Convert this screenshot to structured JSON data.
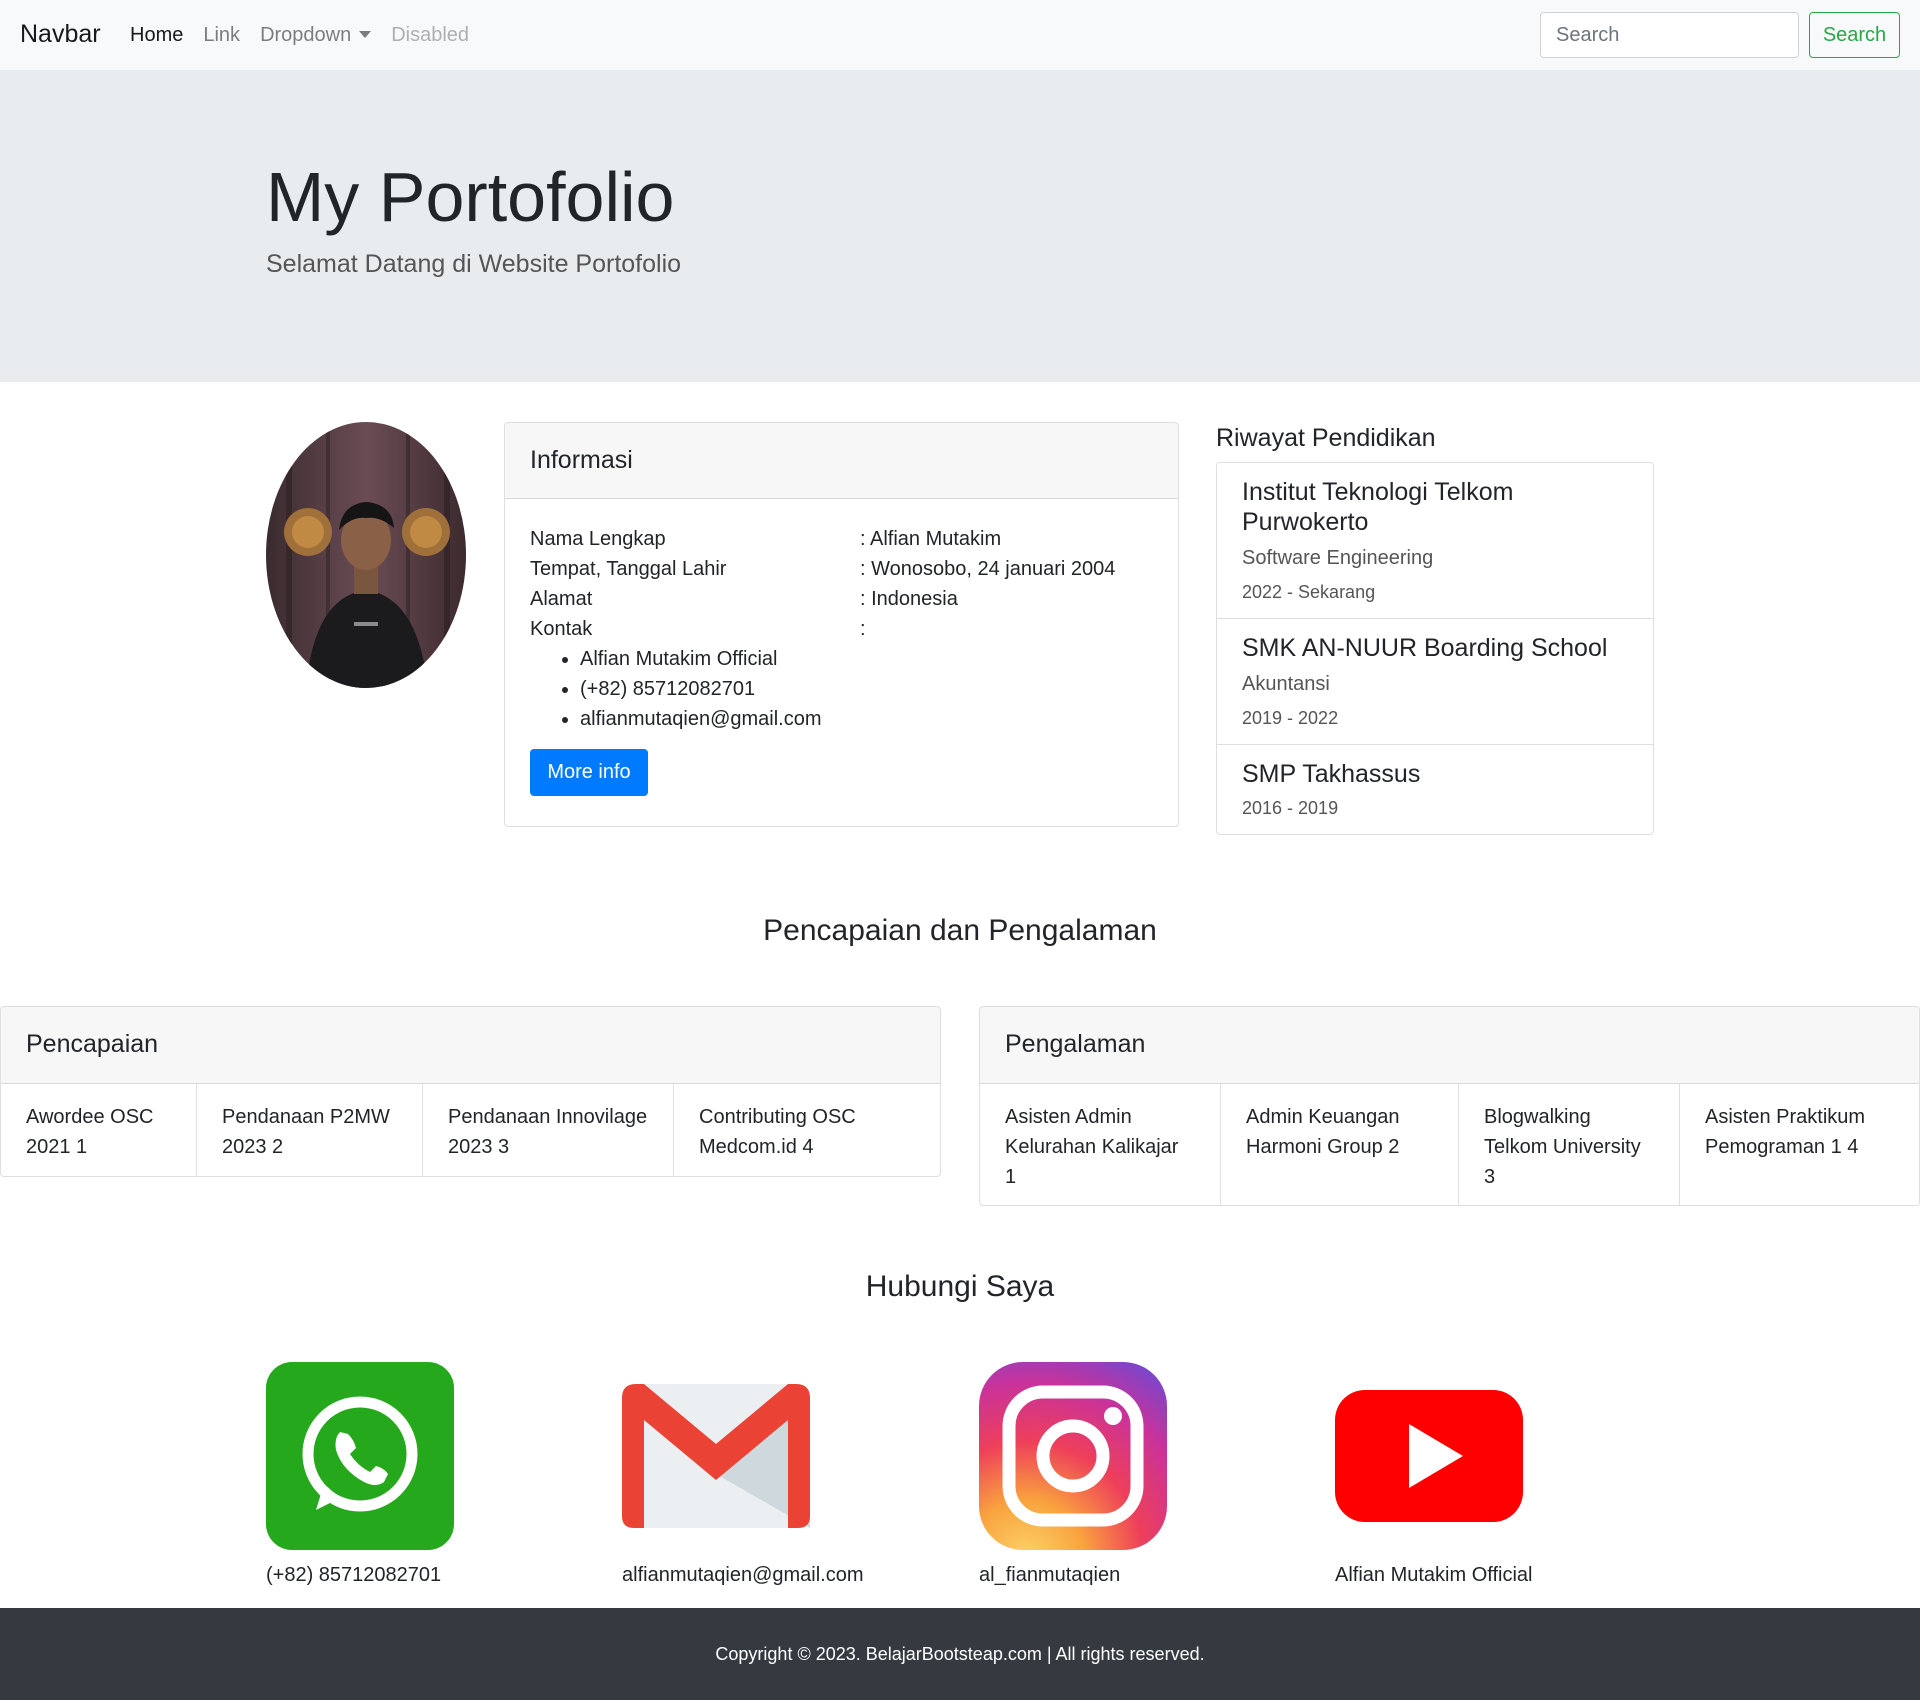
{
  "navbar": {
    "brand": "Navbar",
    "links": [
      {
        "label": "Home"
      },
      {
        "label": "Link"
      },
      {
        "label": "Dropdown"
      },
      {
        "label": "Disabled"
      }
    ],
    "search_placeholder": "Search",
    "search_button": "Search"
  },
  "hero": {
    "title": "My Portofolio",
    "subtitle": "Selamat Datang di Website Portofolio"
  },
  "info": {
    "header": "Informasi",
    "rows": [
      {
        "label": "Nama Lengkap",
        "value": ": Alfian Mutakim"
      },
      {
        "label": "Tempat, Tanggal Lahir",
        "value": ": Wonosobo, 24 januari 2004"
      },
      {
        "label": "Alamat",
        "value": ": Indonesia"
      },
      {
        "label": "Kontak",
        "value": ":"
      }
    ],
    "contacts": [
      "Alfian Mutakim Official",
      "(+82) 85712082701",
      "alfianmutaqien@gmail.com"
    ],
    "more_button": "More info"
  },
  "education": {
    "title": "Riwayat Pendidikan",
    "items": [
      {
        "school": "Institut Teknologi Telkom Purwokerto",
        "major": "Software Engineering",
        "years": "2022 - Sekarang"
      },
      {
        "school": "SMK AN-NUUR Boarding School",
        "major": "Akuntansi",
        "years": "2019 - 2022"
      },
      {
        "school": "SMP Takhassus",
        "major": "",
        "years": "2016 - 2019"
      }
    ]
  },
  "achievements_section": {
    "title": "Pencapaian dan Pengalaman",
    "achievements": {
      "header": "Pencapaian",
      "items": [
        "Awordee OSC 2021 1",
        "Pendanaan P2MW 2023 2",
        "Pendanaan Innovilage 2023 3",
        "Contributing OSC Medcom.id 4"
      ]
    },
    "experience": {
      "header": "Pengalaman",
      "items": [
        "Asisten Admin Kelurahan Kalikajar 1",
        "Admin Keuangan Harmoni Group 2",
        "Blogwalking Telkom University 3",
        "Asisten Praktikum Pemograman 1 4"
      ]
    }
  },
  "contact": {
    "title": "Hubungi Saya",
    "items": [
      {
        "icon": "whatsapp-icon",
        "caption": "(+82) 85712082701"
      },
      {
        "icon": "gmail-icon",
        "caption": "alfianmutaqien@gmail.com"
      },
      {
        "icon": "instagram-icon",
        "caption": "al_fianmutaqien"
      },
      {
        "icon": "youtube-icon",
        "caption": "Alfian Mutakim Official"
      }
    ]
  },
  "footer": {
    "text": "Copyright © 2023. BelajarBootsteap.com | All rights reserved."
  },
  "colors": {
    "primary": "#007bff",
    "success": "#28a745",
    "jumbotron_bg": "#e9ecef",
    "footer_bg": "#343a40",
    "whatsapp": "#25a81c",
    "youtube": "#ff0000",
    "gmail_red": "#ea4335"
  }
}
